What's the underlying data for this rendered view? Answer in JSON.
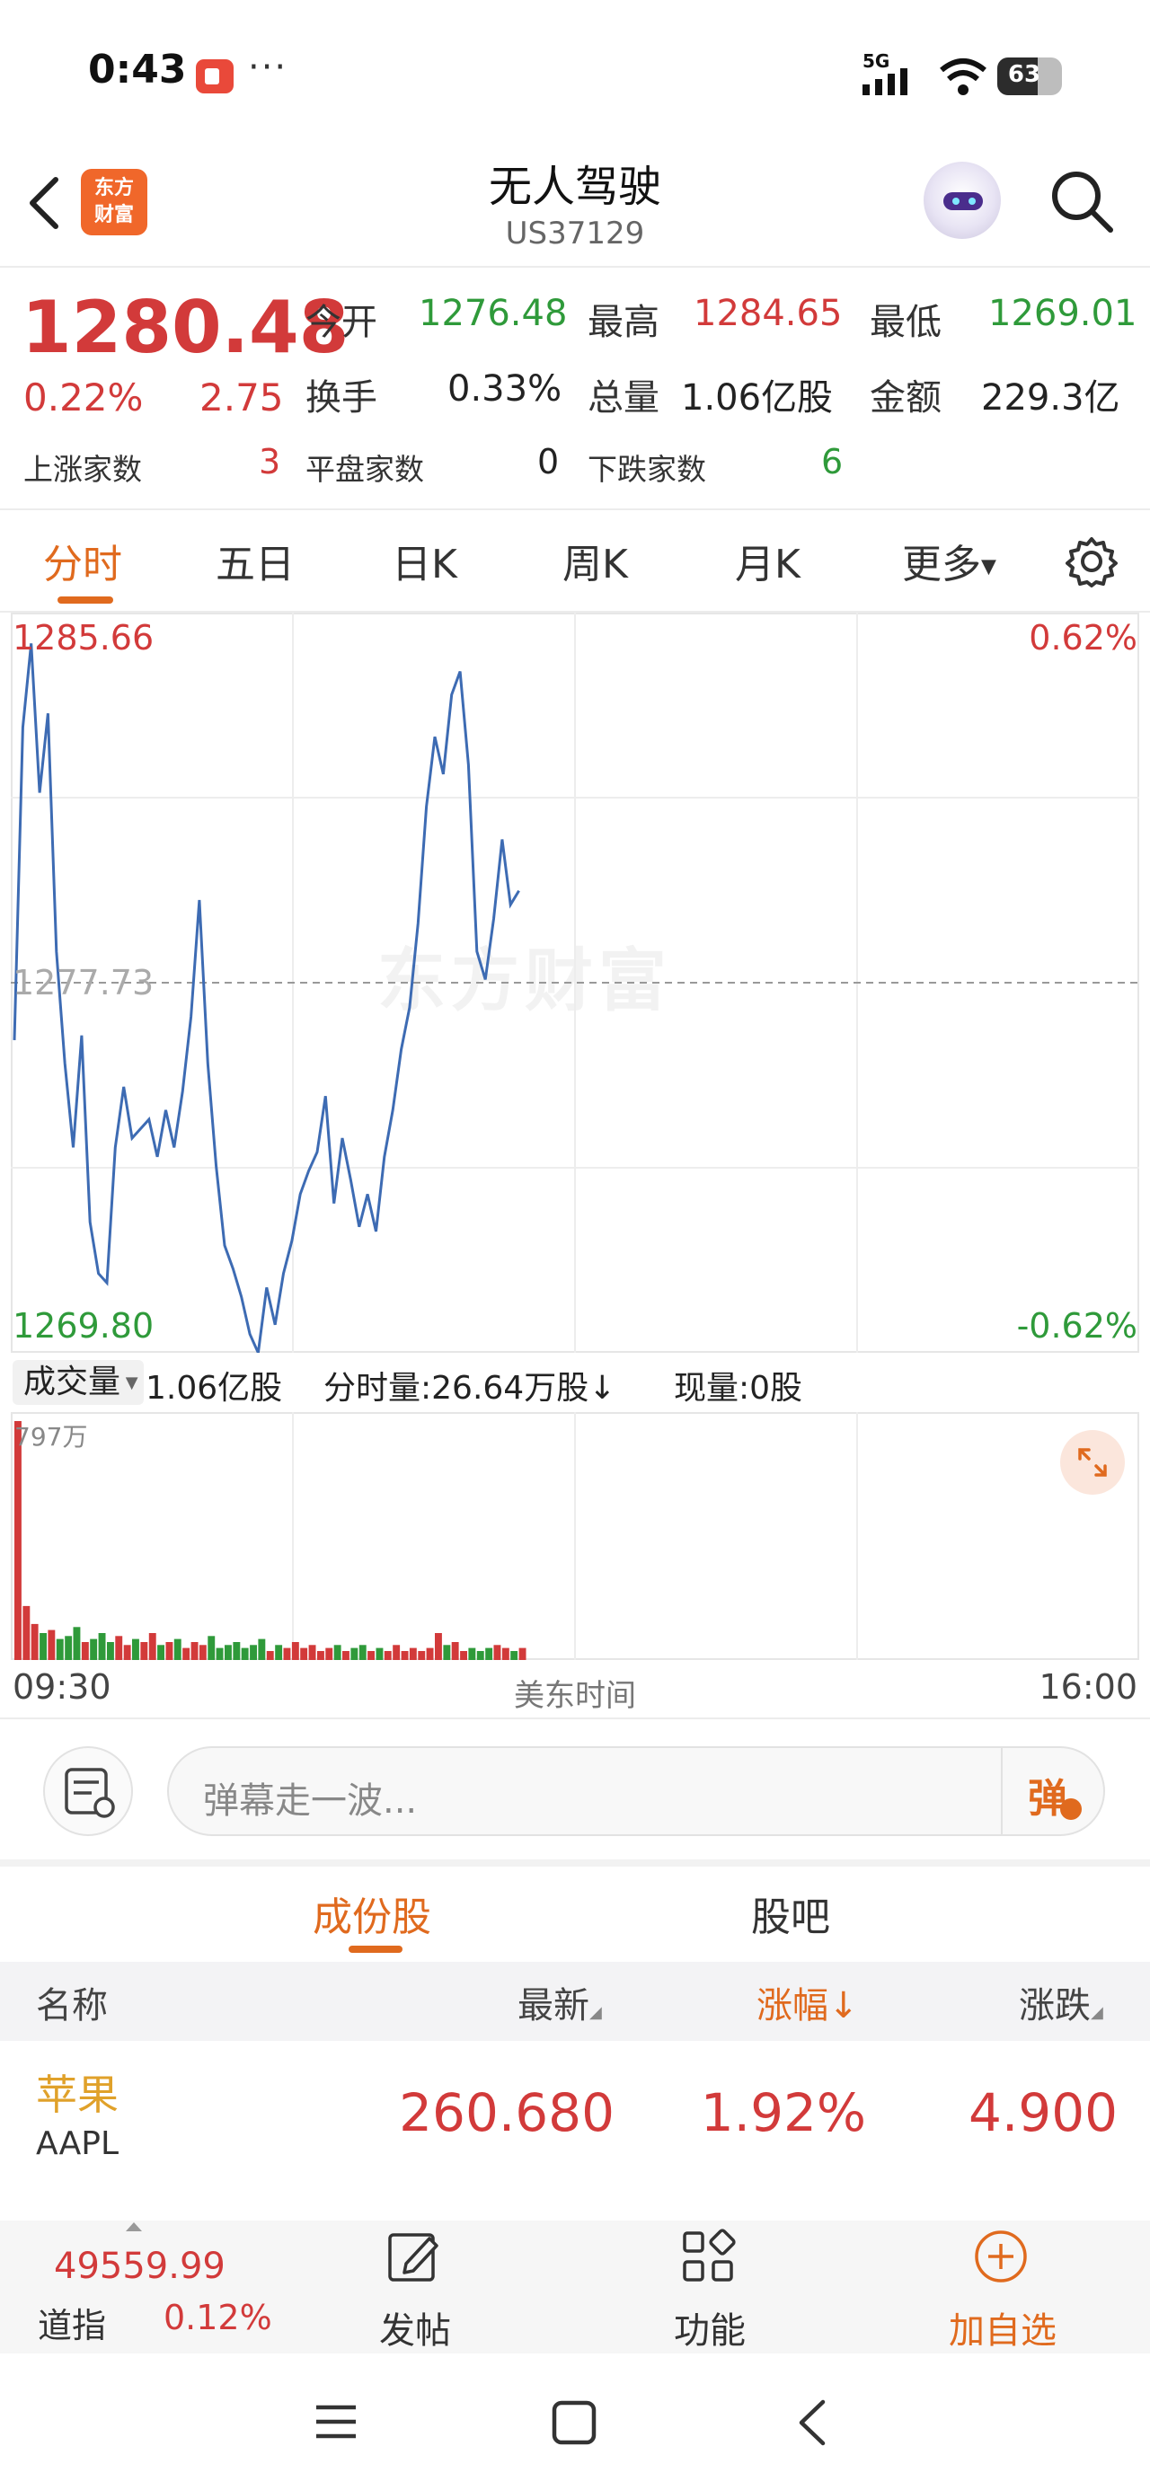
{
  "status_bar": {
    "time": "0:43",
    "dots": "···",
    "network": "5G",
    "battery": "63",
    "battery_level": 0.63
  },
  "header": {
    "brand_logo_line1": "东方",
    "brand_logo_line2": "财富",
    "title": "无人驾驶",
    "code": "US37129"
  },
  "quote": {
    "price": "1280.48",
    "change_pct": "0.22%",
    "change_val": "2.75",
    "open_label": "今开",
    "open": "1276.48",
    "high_label": "最高",
    "high": "1284.65",
    "low_label": "最低",
    "low": "1269.01",
    "turnover_label": "换手",
    "turnover": "0.33%",
    "volume_label": "总量",
    "volume": "1.06亿股",
    "amount_label": "金额",
    "amount": "229.3亿",
    "up_label": "上涨家数",
    "up_count": "3",
    "flat_label": "平盘家数",
    "flat_count": "0",
    "down_label": "下跌家数",
    "down_count": "6"
  },
  "tabs": [
    "分时",
    "五日",
    "日K",
    "周K",
    "月K",
    "更多"
  ],
  "chart": {
    "y_max_label": "1285.66",
    "y_mid_label": "1277.73",
    "y_min_label": "1269.80",
    "pct_max_label": "0.62%",
    "pct_min_label": "-0.62%",
    "watermark": "东方财富",
    "price_series": [
      1276.5,
      1283.2,
      1285.0,
      1281.8,
      1283.5,
      1278.4,
      1276.0,
      1274.2,
      1276.6,
      1272.6,
      1271.5,
      1271.3,
      1274.2,
      1275.5,
      1274.4,
      1274.6,
      1274.8,
      1274.0,
      1275.0,
      1274.2,
      1275.4,
      1277.0,
      1279.5,
      1276.0,
      1273.8,
      1272.1,
      1271.6,
      1271.0,
      1270.2,
      1269.8,
      1271.2,
      1270.4,
      1271.5,
      1272.2,
      1273.2,
      1273.7,
      1274.1,
      1275.3,
      1273.0,
      1274.4,
      1273.5,
      1272.5,
      1273.2,
      1272.4,
      1274.0,
      1275.0,
      1276.3,
      1277.2,
      1279.0,
      1281.5,
      1283.0,
      1282.2,
      1283.9,
      1284.4,
      1282.4,
      1278.4,
      1277.8,
      1279.1,
      1280.8,
      1279.4,
      1279.7
    ],
    "volume_series": [
      7.97,
      1.8,
      1.2,
      0.9,
      1.0,
      0.7,
      0.8,
      1.1,
      0.6,
      0.7,
      0.9,
      0.6,
      0.8,
      0.5,
      0.7,
      0.6,
      0.9,
      0.5,
      0.6,
      0.7,
      0.4,
      0.6,
      0.5,
      0.8,
      0.4,
      0.5,
      0.6,
      0.4,
      0.5,
      0.7,
      0.3,
      0.5,
      0.4,
      0.6,
      0.4,
      0.5,
      0.3,
      0.4,
      0.5,
      0.3,
      0.4,
      0.5,
      0.3,
      0.4,
      0.3,
      0.5,
      0.3,
      0.4,
      0.3,
      0.4,
      0.9,
      0.5,
      0.6,
      0.3,
      0.4,
      0.3,
      0.4,
      0.5,
      0.4,
      0.3,
      0.4
    ],
    "volume_max_label": "797万"
  },
  "volume_bar": {
    "dropdown_label": "成交量",
    "total": "1.06亿股",
    "minute_volume": "分时量:26.64万股",
    "minute_arrow": "↓",
    "current": "现量:0股"
  },
  "time_axis": {
    "start": "09:30",
    "middle": "美东时间",
    "end": "16:00"
  },
  "danmaku": {
    "placeholder": "弹幕走一波...",
    "button": "弹"
  },
  "sub_tabs": [
    "成份股",
    "股吧"
  ],
  "table": {
    "headers": [
      "名称",
      "最新",
      "涨幅",
      "涨跌"
    ],
    "sort_arrow": "↓",
    "rows": [
      {
        "name": "苹果",
        "code": "AAPL",
        "latest": "260.680",
        "pct": "1.92%",
        "change": "4.900"
      }
    ]
  },
  "bottom_bar": {
    "index_value": "49559.99",
    "index_name": "道指",
    "index_pct": "0.12%",
    "post_label": "发帖",
    "function_label": "功能",
    "add_label": "加自选"
  },
  "colors": {
    "up": "#d23a3a",
    "down": "#2f9a3a",
    "accent": "#e06a1e",
    "line": "#3d6bb3"
  }
}
